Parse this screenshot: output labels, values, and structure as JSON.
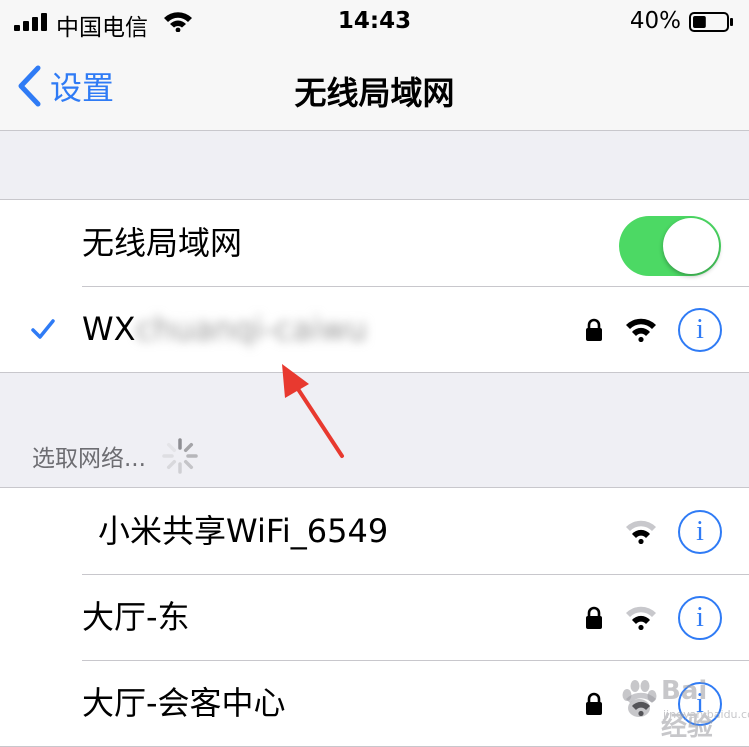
{
  "status_bar": {
    "carrier": "中国电信",
    "time": "14:43",
    "battery_percent": "40%",
    "battery_level": 0.4,
    "icons": [
      "signal-bars-icon",
      "wifi-status-icon",
      "battery-icon"
    ]
  },
  "nav": {
    "back_label": "设置",
    "title": "无线局域网"
  },
  "wifi_toggle": {
    "label": "无线局域网",
    "on": true
  },
  "connected": {
    "ssid_prefix": "WX",
    "ssid_obscured": "chuanqi-caiwu",
    "secured": true
  },
  "section": {
    "choose_network": "选取网络..."
  },
  "networks": [
    {
      "name": "小米共享WiFi_6549",
      "secured": false
    },
    {
      "name": "大厅-东",
      "secured": true
    },
    {
      "name": "大厅-会客中心",
      "secured": true
    }
  ],
  "watermark": {
    "brand": "Bai 经验",
    "url": "jingyan.baidu.com"
  },
  "colors": {
    "accent": "#2f7bf5",
    "toggle_on": "#4cd964",
    "annotation_arrow": "#e8392f"
  }
}
